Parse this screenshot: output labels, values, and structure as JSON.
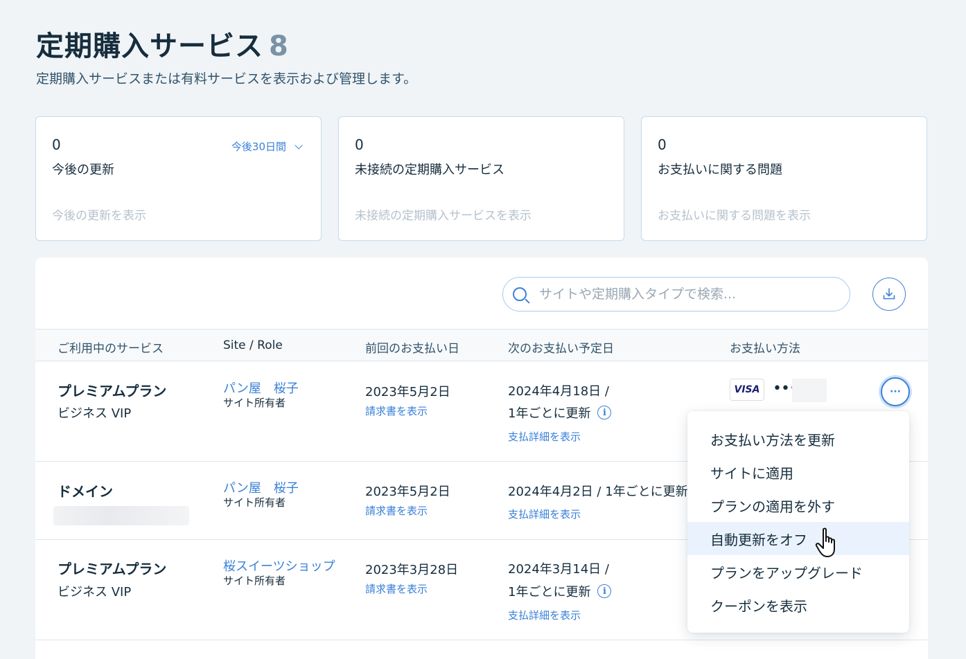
{
  "header": {
    "title": "定期購入サービス",
    "count": "8",
    "subtitle": "定期購入サービスまたは有料サービスを表示および管理します。"
  },
  "cards": [
    {
      "value": "0",
      "label": "今後の更新",
      "link": "今後の更新を表示",
      "period": "今後30日間"
    },
    {
      "value": "0",
      "label": "未接続の定期購入サービス",
      "link": "未接続の定期購入サービスを表示"
    },
    {
      "value": "0",
      "label": "お支払いに関する問題",
      "link": "お支払いに関する問題を表示"
    }
  ],
  "search": {
    "placeholder": "サイトや定期購入タイプで検索..."
  },
  "columns": [
    "ご利用中のサービス",
    "Site / Role",
    "前回のお支払い日",
    "次のお支払い予定日",
    "お支払い方法"
  ],
  "rows": [
    {
      "service": "プレミアムプラン",
      "tier": "ビジネス VIP",
      "site": "パン屋　桜子",
      "role": "サイト所有者",
      "last_payment": "2023年5月2日",
      "invoice": "請求書を表示",
      "next_payment": "2024年4月18日 /",
      "renewal": "1年ごとに更新",
      "pay_detail": "支払詳細を表示",
      "card_brand": "VISA",
      "card_mask": "••••"
    },
    {
      "service": "ドメイン",
      "site": "パン屋　桜子",
      "role": "サイト所有者",
      "last_payment": "2023年5月2日",
      "invoice": "請求書を表示",
      "next_payment": "2024年4月2日 / 1年ごとに更新",
      "pay_detail": "支払詳細を表示"
    },
    {
      "service": "プレミアムプラン",
      "tier": "ビジネス VIP",
      "site": "桜スイーツショップ",
      "role": "サイト所有者",
      "last_payment": "2023年3月28日",
      "invoice": "請求書を表示",
      "next_payment": "2024年3月14日 /",
      "renewal": "1年ごとに更新",
      "pay_detail": "支払詳細を表示"
    }
  ],
  "menu": {
    "items": [
      "お支払い方法を更新",
      "サイトに適用",
      "プランの適用を外す",
      "自動更新をオフ",
      "プランをアップグレード",
      "クーポンを表示"
    ],
    "hovered_index": 3
  },
  "icons": {
    "more": "more-horizontal-icon",
    "info": "info-icon",
    "download": "download-icon",
    "search": "search-icon",
    "cursor": "hand-pointer-icon"
  },
  "colors": {
    "accent": "#3a80d8",
    "text": "#162d3d",
    "background": "#f0f4f7",
    "hover": "#eaf3fd"
  }
}
